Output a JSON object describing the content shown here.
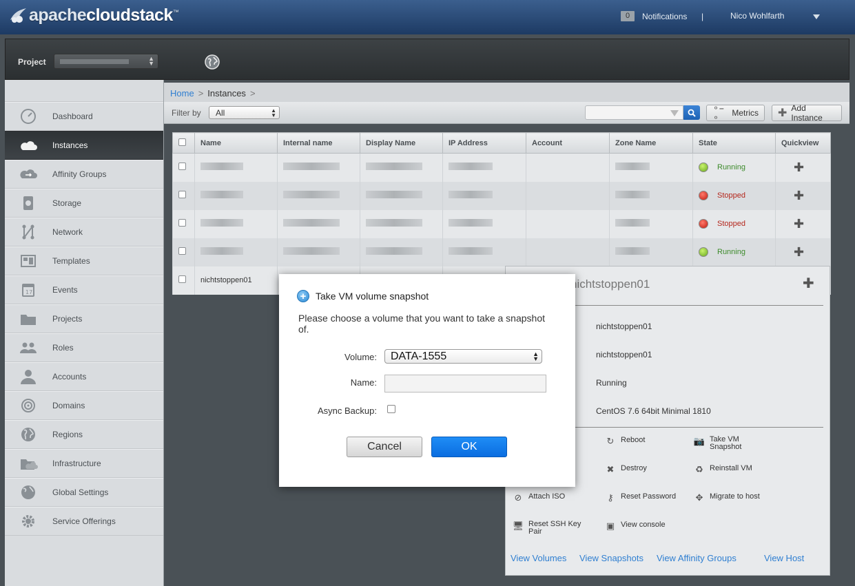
{
  "header": {
    "logo_prefix": "apache",
    "logo_name": "cloudstack",
    "logo_trademark": "™",
    "notifications_count": "0",
    "notifications_label": "Notifications",
    "separator": "|",
    "user_name": "Nico Wohlfarth"
  },
  "project_bar": {
    "label": "Project"
  },
  "sidebar": {
    "items": [
      {
        "label": "Dashboard",
        "icon": "dashboard-icon"
      },
      {
        "label": "Instances",
        "icon": "cloud-icon"
      },
      {
        "label": "Affinity Groups",
        "icon": "affinity-cloud-icon"
      },
      {
        "label": "Storage",
        "icon": "storage-icon"
      },
      {
        "label": "Network",
        "icon": "network-icon"
      },
      {
        "label": "Templates",
        "icon": "templates-icon"
      },
      {
        "label": "Events",
        "icon": "calendar-icon"
      },
      {
        "label": "Projects",
        "icon": "folder-icon"
      },
      {
        "label": "Roles",
        "icon": "roles-icon"
      },
      {
        "label": "Accounts",
        "icon": "person-icon"
      },
      {
        "label": "Domains",
        "icon": "domains-icon"
      },
      {
        "label": "Regions",
        "icon": "globe-icon"
      },
      {
        "label": "Infrastructure",
        "icon": "infrastructure-icon"
      },
      {
        "label": "Global Settings",
        "icon": "global-settings-icon"
      },
      {
        "label": "Service Offerings",
        "icon": "gear-icon"
      }
    ],
    "active_index": 1
  },
  "breadcrumb": {
    "home": "Home",
    "sep": ">",
    "current": "Instances"
  },
  "toolbar": {
    "filter_label": "Filter by",
    "filter_value": "All",
    "metrics_label": "Metrics",
    "add_label": "Add Instance"
  },
  "table": {
    "columns": [
      "Name",
      "Internal name",
      "Display Name",
      "IP Address",
      "Account",
      "Zone Name",
      "State",
      "Quickview"
    ],
    "rows": [
      {
        "name": "",
        "state": "Running"
      },
      {
        "name": "",
        "state": "Stopped"
      },
      {
        "name": "",
        "state": "Stopped"
      },
      {
        "name": "",
        "state": "Running"
      },
      {
        "name": "nichtstoppen01",
        "state": ""
      }
    ]
  },
  "quickview": {
    "title": "nichtstoppen01",
    "fields": [
      "nichtstoppen01",
      "nichtstoppen01",
      "Running",
      "CentOS 7.6 64bit Minimal 1810"
    ],
    "actions": [
      {
        "label": "Reboot",
        "icon": "reboot-icon"
      },
      {
        "label": "Take VM Snapshot",
        "icon": "camera-icon"
      },
      {
        "label": "Destroy",
        "icon": "destroy-icon"
      },
      {
        "label": "Reinstall VM",
        "icon": "reinstall-icon"
      },
      {
        "label": "Attach ISO",
        "icon": "attach-iso-icon"
      },
      {
        "label": "Reset Password",
        "icon": "key-icon"
      },
      {
        "label": "Migrate to host",
        "icon": "migrate-icon"
      },
      {
        "label": "Reset SSH Key Pair",
        "icon": "ssh-key-icon"
      },
      {
        "label": "View console",
        "icon": "console-icon"
      }
    ],
    "links": [
      "View Volumes",
      "View Snapshots",
      "View Affinity Groups",
      "View Host"
    ]
  },
  "modal": {
    "title": "Take VM volume snapshot",
    "description": "Please choose a volume that you want to take a snapshot of.",
    "volume_label": "Volume:",
    "volume_value": "DATA-1555",
    "name_label": "Name:",
    "name_value": "",
    "async_label": "Async Backup:",
    "cancel_label": "Cancel",
    "ok_label": "OK"
  },
  "colors": {
    "header_top": "#3b5f8e",
    "link": "#2f7fd1",
    "ok_button": "#1f8df6",
    "running": "#3c8a2a",
    "stopped": "#b4261b"
  }
}
